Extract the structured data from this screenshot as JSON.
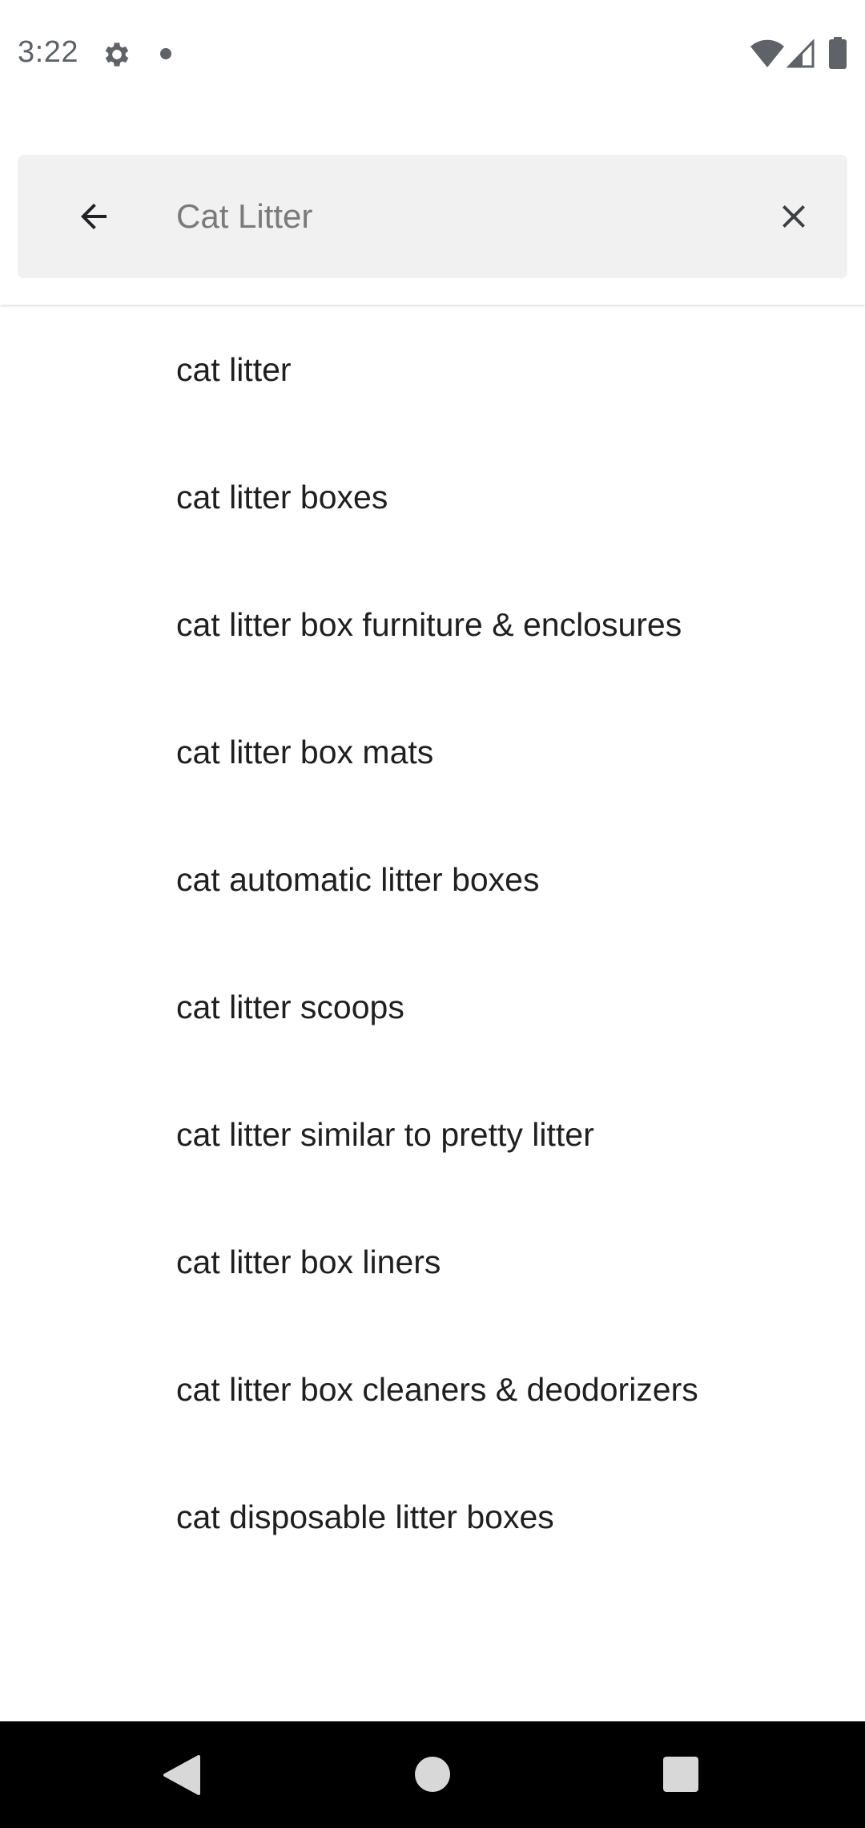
{
  "status_bar": {
    "time": "3:22",
    "icons": [
      "gear-icon",
      "notification-dot-icon",
      "wifi-icon",
      "signal-icon",
      "battery-icon"
    ]
  },
  "search": {
    "query": "",
    "placeholder": "Cat Litter",
    "back_icon": "arrow-back-icon",
    "clear_icon": "close-icon"
  },
  "suggestions": [
    "cat litter",
    "cat litter boxes",
    "cat litter box furniture & enclosures",
    "cat litter box mats",
    "cat automatic litter boxes",
    "cat litter scoops",
    "cat litter similar to pretty litter",
    "cat litter box liners",
    "cat litter box cleaners & deodorizers",
    "cat disposable litter boxes"
  ],
  "nav_bar": {
    "icons": [
      "nav-back-icon",
      "nav-home-icon",
      "nav-recents-icon"
    ]
  },
  "colors": {
    "search_box_bg": "#f1f1f1",
    "text": "#1f1f1f",
    "placeholder": "#7a7a7a",
    "nav_bar_bg": "#000000"
  }
}
